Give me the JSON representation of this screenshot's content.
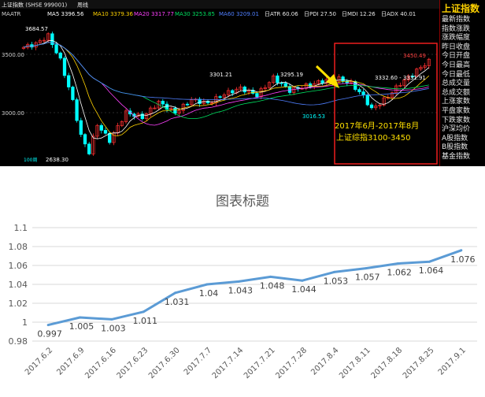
{
  "stock_panel": {
    "title": "上证指数 (SHSE 999001)",
    "period": "周线",
    "indicators": [
      {
        "label": "MAATR",
        "color": "#cfcfcf"
      },
      {
        "label": "MA5 3396.56",
        "color": "#ffffff"
      },
      {
        "label": "MA10 3379.36",
        "color": "#ffd200"
      },
      {
        "label": "MA20 3317.77",
        "color": "#ff40ff"
      },
      {
        "label": "MA30 3253.85",
        "color": "#00e060"
      },
      {
        "label": "MA60 3209.01",
        "color": "#4f7fff"
      },
      {
        "label": "日ATR 60.06",
        "color": "#e8e8e8"
      },
      {
        "label": "日PDI 27.50",
        "color": "#e8e8e8"
      },
      {
        "label": "日MDI 12.26",
        "color": "#e8e8e8"
      },
      {
        "label": "日ADX 40.01",
        "color": "#e8e8e8"
      }
    ],
    "axis_labels": [
      "3500.00",
      "3000.00"
    ],
    "price_annotations": {
      "high_left": "3684.57",
      "low": "2638.30",
      "mid_high_1": "3301.21",
      "mid_high_2": "3295.19",
      "recent_low": "3016.53",
      "recent_high": "3450.49",
      "current_range": "3332.60 - 3331.91"
    },
    "bottom_label": "100周",
    "caption_line1": "2017年6月-2017年8月",
    "caption_line2": "上证综指3100-3450",
    "colors": {
      "up": "#ff3030",
      "down": "#00ffff",
      "highlight_box": "#ff2020",
      "arrow": "#ffe000",
      "caption": "#ffe000"
    }
  },
  "side_panel": {
    "title": "上证指数",
    "items": [
      "最新指数",
      "指数涨跌",
      "涨跌幅度",
      "昨日收盘",
      "今日开盘",
      "今日最高",
      "今日最低",
      "总成交量",
      "总成交额",
      "上涨家数",
      "平盘家数",
      "下跌家数",
      "沪深均价",
      "A股指数",
      "B股指数",
      "基金指数"
    ]
  },
  "chart_data": {
    "type": "line",
    "title": "图表标题",
    "x": [
      "2017.6.2",
      "2017.6.9",
      "2017.6.16",
      "2017.6.23",
      "2017.6.30",
      "2017.7.7",
      "2017.7.14",
      "2017.7.21",
      "2017.7.28",
      "2017.8.4",
      "2017.8.11",
      "2017.8.18",
      "2017.8.25",
      "2017.9.1"
    ],
    "values": [
      0.997,
      1.005,
      1.003,
      1.011,
      1.031,
      1.04,
      1.043,
      1.048,
      1.044,
      1.053,
      1.057,
      1.062,
      1.064,
      1.076
    ],
    "labels": [
      "0.997",
      "1.005",
      "1.003",
      "1.011",
      "1.031",
      "1.04",
      "1.043",
      "1.048",
      "1.044",
      "1.053",
      "1.057",
      "1.062",
      "1.064",
      "1.076"
    ],
    "yticks": [
      "0.98",
      "1",
      "1.02",
      "1.04",
      "1.06",
      "1.08",
      "1.1"
    ],
    "ylim": [
      0.98,
      1.1
    ],
    "grid": true,
    "line_color": "#5b9bd5"
  }
}
